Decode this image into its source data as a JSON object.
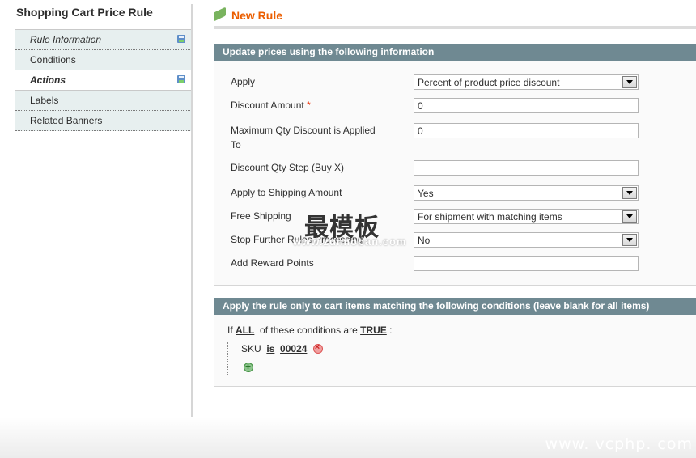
{
  "sidebar": {
    "title": "Shopping Cart Price Rule",
    "tabs": [
      {
        "label": "Rule Information",
        "icon": "save-icon",
        "state": "changed"
      },
      {
        "label": "Conditions"
      },
      {
        "label": "Actions",
        "icon": "save-icon",
        "state": "active"
      },
      {
        "label": "Labels"
      },
      {
        "label": "Related Banners"
      }
    ]
  },
  "page": {
    "title": "New Rule",
    "icon": "rule-money-icon",
    "accent_color": "#eb5e00"
  },
  "actions_fieldset": {
    "heading": "Update prices using the following information",
    "fields": [
      {
        "label": "Apply",
        "type": "select",
        "value": "Percent of product price discount"
      },
      {
        "label": "Discount Amount",
        "required_marker": "*",
        "type": "input",
        "value": "0"
      },
      {
        "label": "Maximum Qty Discount is Applied To",
        "type": "input",
        "value": "0"
      },
      {
        "label": "Discount Qty Step (Buy X)",
        "type": "input",
        "value": ""
      },
      {
        "label": "Apply to Shipping Amount",
        "type": "select",
        "value": "Yes"
      },
      {
        "label": "Free Shipping",
        "type": "select",
        "value": "For shipment with matching items"
      },
      {
        "label": "Stop Further Rules Processing",
        "type": "select",
        "value": "No"
      },
      {
        "label": "Add Reward Points",
        "type": "input",
        "value": ""
      }
    ]
  },
  "conditions_fieldset": {
    "heading": "Apply the rule only to cart items matching the following conditions (leave blank for all items)",
    "prefix": "If",
    "aggregator": "ALL",
    "middle": "of these conditions are",
    "value": "TRUE",
    "suffix": ":",
    "conditions": [
      {
        "attribute": "SKU",
        "operator": "is",
        "value": "00024"
      }
    ]
  },
  "watermarks": {
    "cn": "最模板",
    "cn_url": "www.zuimoban.com",
    "bottom": "www. vcphp. com"
  }
}
